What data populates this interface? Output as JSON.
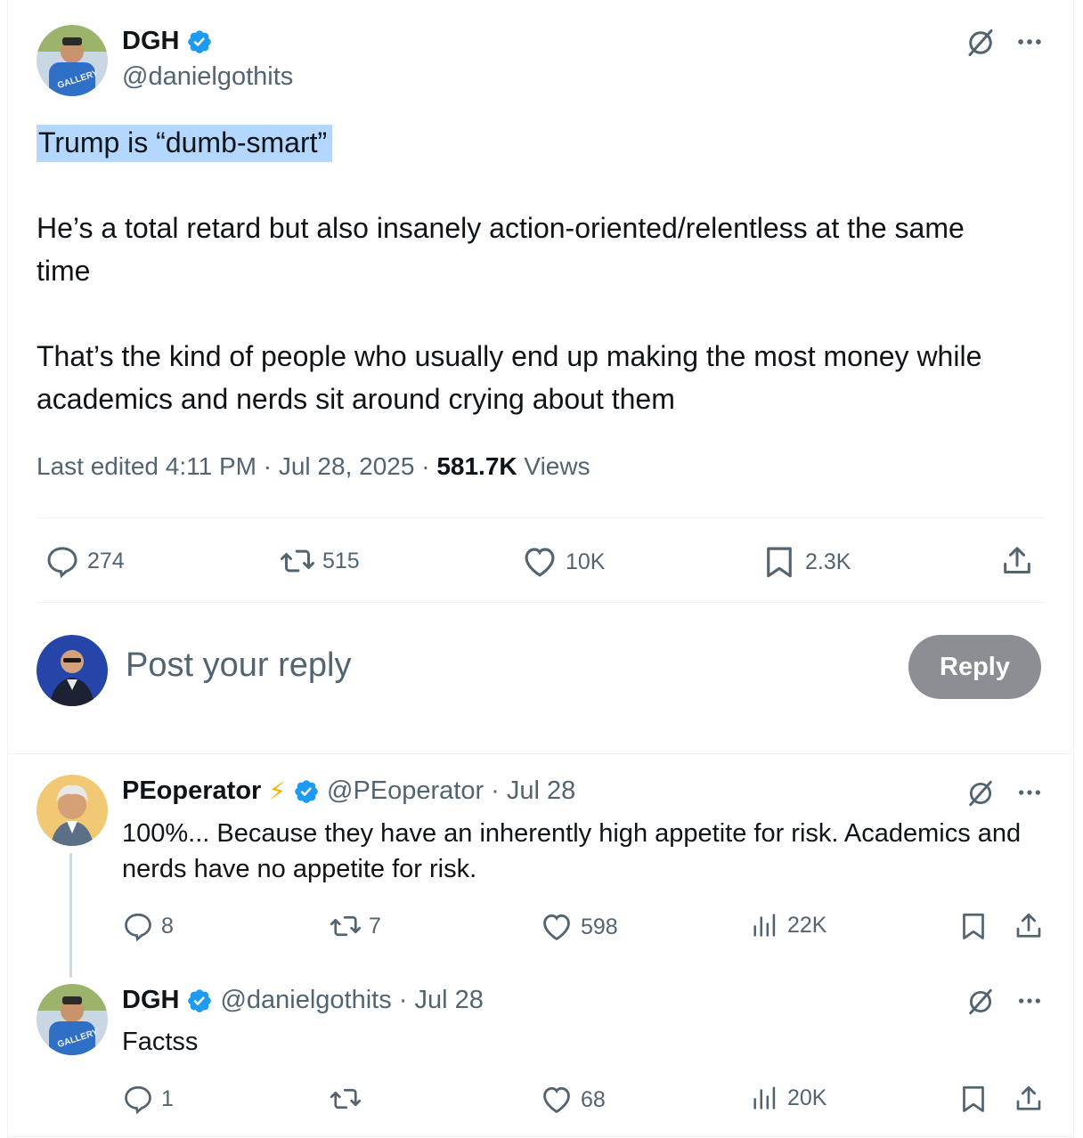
{
  "main_tweet": {
    "author": {
      "name": "DGH",
      "handle": "@danielgothits"
    },
    "lines": {
      "highlight": "Trump is “dumb-smart”",
      "p1": "He’s a total retard but also insanely action-oriented/relentless at the same time",
      "p2": "That’s the kind of people who usually end up making the most money while academics and nerds sit around crying about them"
    },
    "meta": {
      "edited": "Last edited 4:11 PM",
      "date": "Jul 28, 2025",
      "views_count": "581.7K",
      "views_label": "Views"
    },
    "stats": {
      "replies": "274",
      "reposts": "515",
      "likes": "10K",
      "bookmarks": "2.3K"
    }
  },
  "composer": {
    "placeholder": "Post your reply",
    "button": "Reply"
  },
  "replies": [
    {
      "name": "PEoperator",
      "emoji": "⚡",
      "handle": "@PEoperator",
      "date": "· Jul 28",
      "text": "100%... Because they have an inherently high appetite for risk. Academics and nerds have no appetite for risk.",
      "stats": {
        "replies": "8",
        "reposts": "7",
        "likes": "598",
        "views": "22K"
      }
    },
    {
      "name": "DGH",
      "handle": "@danielgothits",
      "date": "· Jul 28",
      "text": "Factss",
      "stats": {
        "replies": "1",
        "reposts": "",
        "likes": "68",
        "views": "20K"
      }
    }
  ],
  "icons": {
    "verified": "verified-badge-icon",
    "grok": "grok-icon",
    "more": "more-icon",
    "reply": "reply-icon",
    "repost": "repost-icon",
    "like": "heart-icon",
    "bookmark": "bookmark-icon",
    "share": "share-icon",
    "views": "views-icon"
  },
  "colors": {
    "verified": "#1d9bf0",
    "muted": "#536471",
    "highlight": "#b3d7ff",
    "reply_button": "#8b8f93"
  }
}
